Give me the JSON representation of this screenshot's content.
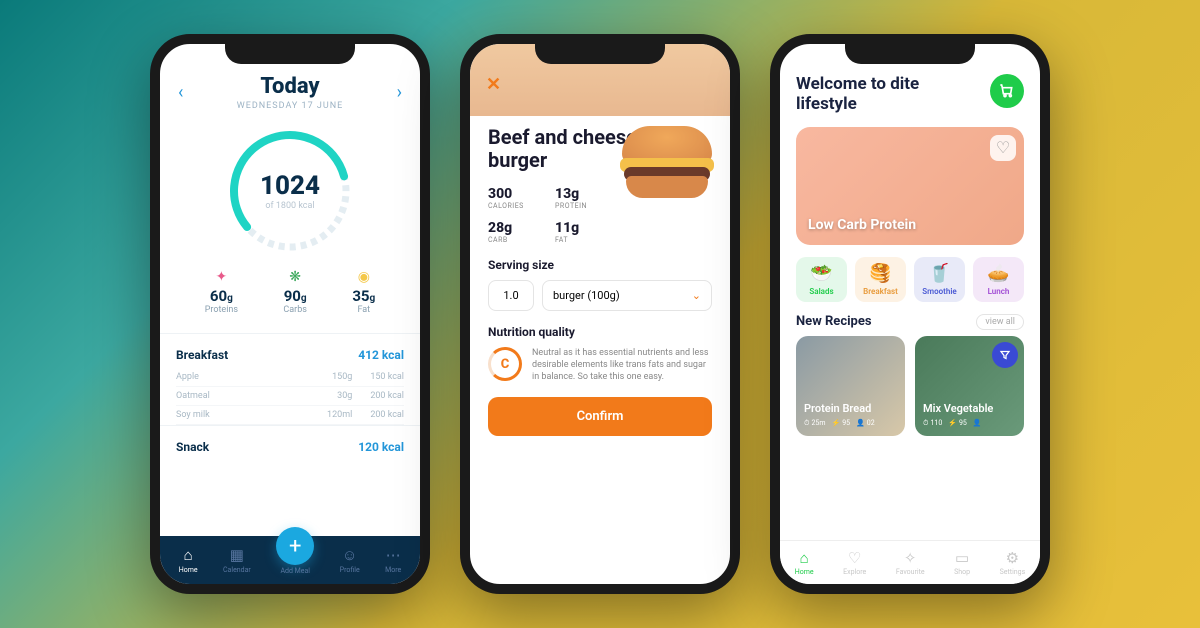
{
  "phone1": {
    "title": "Today",
    "date": "WEDNESDAY 17 JUNE",
    "gauge": {
      "value": "1024",
      "sub": "of 1800 kcal"
    },
    "macros": [
      {
        "icon": "✦",
        "color": "#e85a8a",
        "value": "60",
        "unit": "g",
        "label": "Proteins"
      },
      {
        "icon": "❋",
        "color": "#3aa85a",
        "value": "90",
        "unit": "g",
        "label": "Carbs"
      },
      {
        "icon": "◉",
        "color": "#f4c84a",
        "value": "35",
        "unit": "g",
        "label": "Fat"
      }
    ],
    "meals": [
      {
        "name": "Breakfast",
        "kcal": "412 kcal",
        "items": [
          {
            "name": "Apple",
            "amt": "150g",
            "kcal": "150 kcal"
          },
          {
            "name": "Oatmeal",
            "amt": "30g",
            "kcal": "200 kcal"
          },
          {
            "name": "Soy milk",
            "amt": "120ml",
            "kcal": "200 kcal"
          }
        ]
      },
      {
        "name": "Snack",
        "kcal": "120 kcal",
        "items": []
      }
    ],
    "nav": [
      {
        "icon": "⌂",
        "label": "Home",
        "active": true
      },
      {
        "icon": "▦",
        "label": "Calendar"
      },
      {
        "icon": "+",
        "label": "Add Meal",
        "fab": true
      },
      {
        "icon": "☺",
        "label": "Profile"
      },
      {
        "icon": "⋯",
        "label": "More"
      }
    ]
  },
  "phone2": {
    "title": "Beef and cheese burger",
    "nutrition": [
      {
        "value": "300",
        "label": "CALORIES"
      },
      {
        "value": "13g",
        "label": "PROTEIN"
      },
      {
        "value": "28g",
        "label": "CARB"
      },
      {
        "value": "11g",
        "label": "FAT"
      }
    ],
    "serving_label": "Serving size",
    "serving_qty": "1.0",
    "serving_unit": "burger (100g)",
    "quality_label": "Nutrition quality",
    "quality_grade": "C",
    "quality_text": "Neutral as it has essential nutrients and less desirable elements like trans fats and sugar in balance. So take this one easy.",
    "confirm": "Confirm"
  },
  "phone3": {
    "title": "Welcome to dite lifestyle",
    "hero_card": "Low Carb Protein",
    "categories": [
      {
        "icon": "🥗",
        "label": "Salads"
      },
      {
        "icon": "🥞",
        "label": "Breakfast"
      },
      {
        "icon": "🥤",
        "label": "Smoothie"
      },
      {
        "icon": "🥧",
        "label": "Lunch"
      }
    ],
    "section": "New Recipes",
    "view_all": "view all",
    "recipes": [
      {
        "name": "Protein Bread",
        "time": "25m",
        "energy": "95",
        "serves": "02"
      },
      {
        "name": "Mix Vegetable",
        "time": "110",
        "energy": "95",
        "serves": ""
      }
    ],
    "nav": [
      {
        "icon": "⌂",
        "label": "Home",
        "active": true
      },
      {
        "icon": "♡",
        "label": "Explore"
      },
      {
        "icon": "✧",
        "label": "Favourite"
      },
      {
        "icon": "▭",
        "label": "Shop"
      },
      {
        "icon": "⚙",
        "label": "Settings"
      }
    ]
  }
}
